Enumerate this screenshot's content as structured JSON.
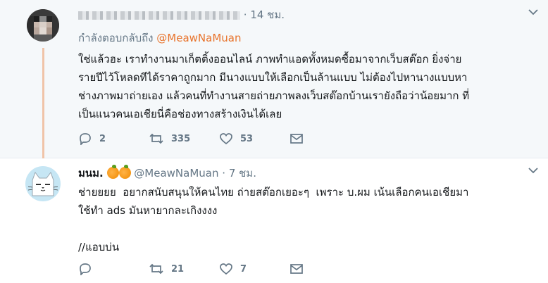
{
  "tweet1": {
    "name": "",
    "time": "· 14 ชม.",
    "replying_prefix": "กำลังตอบกลับถึง",
    "replying_handle": "@MeawNaMuan",
    "text": "ใช่แล้วฮะ เราทำงานมาเก็ตติ้งออนไลน์ ภาพทำแอดทั้งหมดซื้อมาจากเว็บสต๊อก ยิ่งจ่าย\nรายปีไว้โหลดทีได้ราคาถูกมาก มีนางแบบให้เลือกเป็นล้านแบบ ไม่ต้องไปหานางแบบหา\nช่างภาพมาถ่ายเอง แล้วคนที่ทำงานสายถ่ายภาพลงเว็บสต๊อกบ้านเรายังถือว่าน้อยมาก ที่\nเป็นแนวคนเอเชียนี่คือช่องทางสร้างเงินได้เลย",
    "replies": "2",
    "retweets": "335",
    "likes": "53"
  },
  "tweet2": {
    "name": "มนม.",
    "handle": "@MeawNaMuan",
    "time": "· 7 ชม.",
    "text": "ช่ายยยย  อยากสนับสนุนให้คนไทย ถ่ายสต๊อกเยอะๆ  เพราะ บ.ผม เน้นเลือกคนเอเชียมา\nใช้ทำ ads มันหายากละเกิงงงง\n\n//แอบบ่น",
    "retweets": "21",
    "likes": "7"
  },
  "colors": {
    "accent": "#e8742d",
    "muted": "#657786",
    "thread": "#f0c4a8"
  }
}
